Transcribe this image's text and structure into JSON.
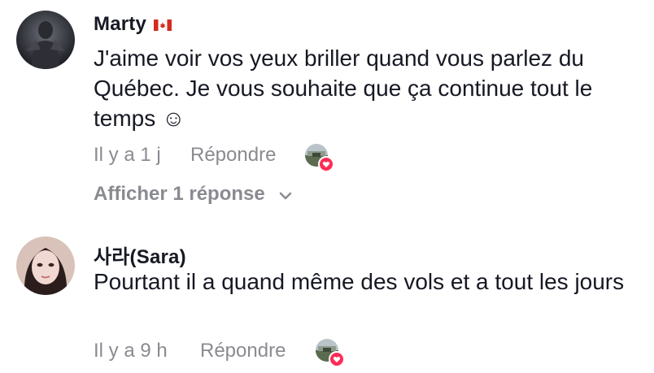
{
  "comments": [
    {
      "author": "Marty",
      "author_flag": "canada-flag",
      "text": "J'aime voir vos yeux briller quand vous parlez du Québec. Je vous souhaite que ça continue tout le temps ☺",
      "time": "Il y a 1 j",
      "reply_label": "Répondre",
      "liked_by_creator": true,
      "replies_label": "Afficher 1 réponse",
      "replies_icon": "chevron-down-icon"
    },
    {
      "author": "사라(Sara)",
      "text": "Pourtant il a quand même des vols et a tout les jours",
      "time": "Il y a 9 h",
      "reply_label": "Répondre",
      "liked_by_creator": true
    }
  ],
  "colors": {
    "primary_text": "#161823",
    "secondary_text": "#8a8b91",
    "like_badge": "#fe2c55"
  }
}
